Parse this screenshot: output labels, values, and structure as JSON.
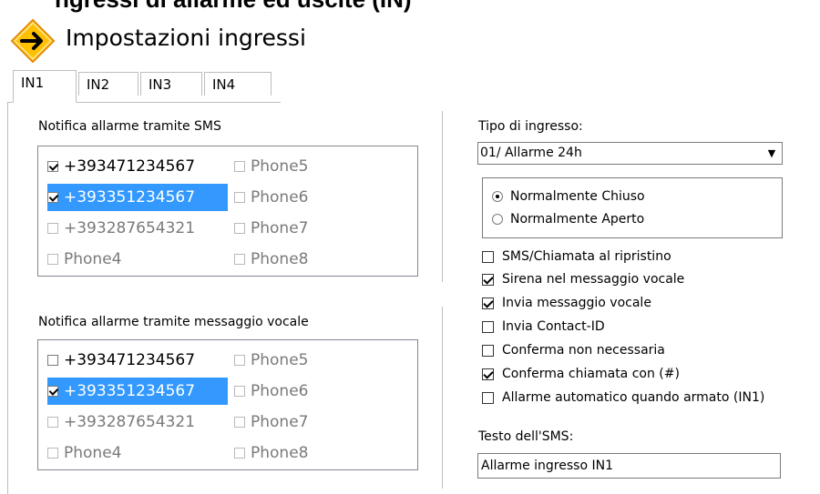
{
  "cut_title": "ngressi di allarme ed uscite (IN)",
  "header": {
    "icon": "arrow-right-diamond-icon",
    "title": "Impostazioni ingressi"
  },
  "tabs": [
    {
      "label": "IN1",
      "active": true
    },
    {
      "label": "IN2"
    },
    {
      "label": "IN3"
    },
    {
      "label": "IN4"
    }
  ],
  "sms_group": {
    "label": "Notifica allarme tramite SMS",
    "items": [
      {
        "label": "+393471234567",
        "checked": true,
        "state": "strong"
      },
      {
        "label": "Phone5",
        "checked": false,
        "state": "dim"
      },
      {
        "label": "+393351234567",
        "checked": true,
        "state": "selected"
      },
      {
        "label": "Phone6",
        "checked": false,
        "state": "dim"
      },
      {
        "label": "+393287654321",
        "checked": false,
        "state": "dim"
      },
      {
        "label": "Phone7",
        "checked": false,
        "state": "dim"
      },
      {
        "label": "Phone4",
        "checked": false,
        "state": "dim"
      },
      {
        "label": "Phone8",
        "checked": false,
        "state": "dim"
      }
    ]
  },
  "voice_group": {
    "label": "Notifica allarme tramite messaggio vocale",
    "items": [
      {
        "label": "+393471234567",
        "checked": false,
        "state": "strong"
      },
      {
        "label": "Phone5",
        "checked": false,
        "state": "dim"
      },
      {
        "label": "+393351234567",
        "checked": true,
        "state": "selected"
      },
      {
        "label": "Phone6",
        "checked": false,
        "state": "dim"
      },
      {
        "label": "+393287654321",
        "checked": false,
        "state": "dim"
      },
      {
        "label": "Phone7",
        "checked": false,
        "state": "dim"
      },
      {
        "label": "Phone4",
        "checked": false,
        "state": "dim"
      },
      {
        "label": "Phone8",
        "checked": false,
        "state": "dim"
      }
    ]
  },
  "input_type": {
    "label": "Tipo di ingresso:",
    "value": "01/ Allarme 24h",
    "arrow_icon": "dropdown-arrow-icon"
  },
  "contact_mode": {
    "options": [
      {
        "label": "Normalmente Chiuso",
        "selected": true
      },
      {
        "label": "Normalmente Aperto",
        "selected": false
      }
    ]
  },
  "options": [
    {
      "label": "SMS/Chiamata al ripristino",
      "checked": false
    },
    {
      "label": "Sirena nel messaggio vocale",
      "checked": true
    },
    {
      "label": "Invia messaggio vocale",
      "checked": true
    },
    {
      "label": "Invia Contact-ID",
      "checked": false
    },
    {
      "label": "Conferma non necessaria",
      "checked": false
    },
    {
      "label": "Conferma chiamata con (#)",
      "checked": true
    },
    {
      "label": "Allarme automatico quando armato (IN1)",
      "checked": false
    }
  ],
  "sms_text": {
    "label": "Testo dell'SMS:",
    "value": "Allarme ingresso IN1"
  },
  "colors": {
    "selection": "#3399ff",
    "border": "#bdbdbd",
    "icon_fill": "#ffc000",
    "icon_border": "#e58a00"
  }
}
